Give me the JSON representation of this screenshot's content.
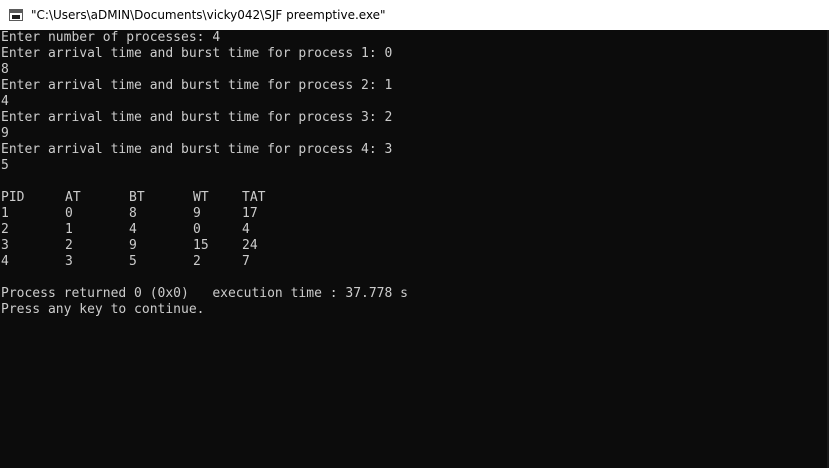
{
  "window": {
    "title": "\"C:\\Users\\aDMIN\\Documents\\vicky042\\SJF preemptive.exe\""
  },
  "console": {
    "prompt_count": "Enter number of processes: 4",
    "inputs": [
      {
        "prompt": "Enter arrival time and burst time for process 1: 0",
        "continuation": "8"
      },
      {
        "prompt": "Enter arrival time and burst time for process 2: 1",
        "continuation": "4"
      },
      {
        "prompt": "Enter arrival time and burst time for process 3: 2",
        "continuation": "9"
      },
      {
        "prompt": "Enter arrival time and burst time for process 4: 3",
        "continuation": "5"
      }
    ],
    "table": {
      "headers": [
        "PID",
        "AT",
        "BT",
        "WT",
        "TAT"
      ],
      "rows": [
        [
          "1",
          "0",
          "8",
          "9",
          "17"
        ],
        [
          "2",
          "1",
          "4",
          "0",
          "4"
        ],
        [
          "3",
          "2",
          "9",
          "15",
          "24"
        ],
        [
          "4",
          "3",
          "5",
          "2",
          "7"
        ]
      ]
    },
    "footer": {
      "returned": "Process returned 0 (0x0)   execution time : 37.778 s",
      "continue": "Press any key to continue."
    }
  }
}
